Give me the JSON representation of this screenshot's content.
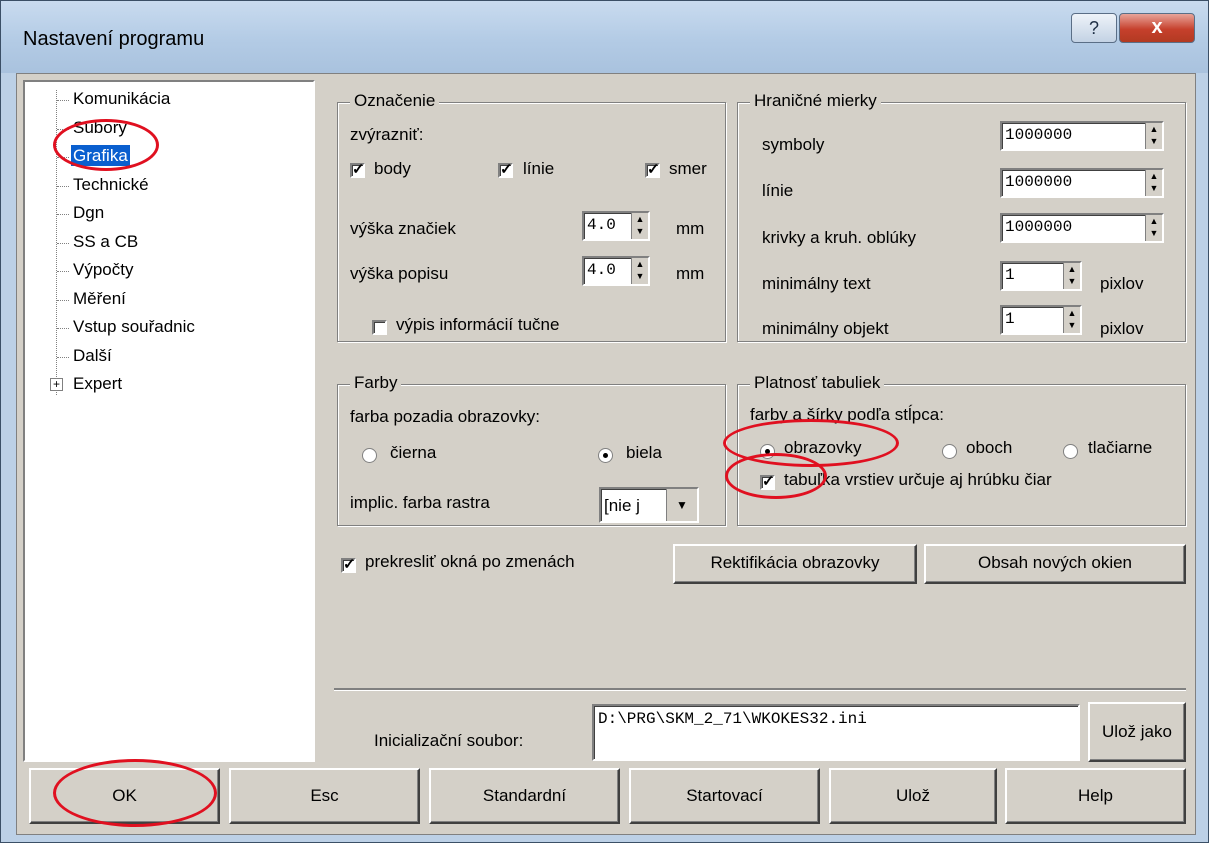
{
  "window": {
    "title": "Nastavení programu",
    "help_symbol": "?",
    "close_symbol": "x"
  },
  "tree": {
    "items": [
      {
        "label": "Komunikácia"
      },
      {
        "label": "Súbory"
      },
      {
        "label": "Grafika",
        "selected": true
      },
      {
        "label": "Technické"
      },
      {
        "label": "Dgn"
      },
      {
        "label": "SS a CB"
      },
      {
        "label": "Výpočty"
      },
      {
        "label": "Měření"
      },
      {
        "label": "Vstup souřadnic"
      },
      {
        "label": "Další"
      },
      {
        "label": "Expert",
        "expandable": true,
        "expander": "+"
      }
    ]
  },
  "oznacenie": {
    "legend": "Označenie",
    "zvyraznit_label": "zvýrazniť:",
    "checkboxes": [
      {
        "label": "body",
        "checked": true
      },
      {
        "label": "línie",
        "checked": true
      },
      {
        "label": "smer",
        "checked": true
      }
    ],
    "vyska_znaciek": {
      "label": "výška značiek",
      "value": "4.0",
      "unit": "mm"
    },
    "vyska_popisu": {
      "label": "výška popisu",
      "value": "4.0",
      "unit": "mm"
    },
    "vypis_tucne": {
      "label": "výpis informácií tučne",
      "checked": false
    }
  },
  "hranicne": {
    "legend": "Hraničné mierky",
    "symboly": {
      "label": "symboly",
      "value": "1000000"
    },
    "linie": {
      "label": "línie",
      "value": "1000000"
    },
    "krivky": {
      "label": "krivky a kruh. oblúky",
      "value": "1000000"
    },
    "min_text": {
      "label": "minimálny text",
      "value": "1",
      "unit": "pixlov"
    },
    "min_objekt": {
      "label": "minimálny objekt",
      "value": "1",
      "unit": "pixlov"
    }
  },
  "farby": {
    "legend": "Farby",
    "pozadie_label": "farba pozadia obrazovky:",
    "cierna": {
      "label": "čierna",
      "selected": false
    },
    "biela": {
      "label": "biela",
      "selected": true
    },
    "raster_label": "implic. farba rastra",
    "raster_value": "[nie j"
  },
  "platnost": {
    "legend": "Platnosť tabuliek",
    "sirky_label": "farby a šírky podľa stĺpca:",
    "obrazovky": {
      "label": "obrazovky",
      "selected": true
    },
    "oboch": {
      "label": "oboch",
      "selected": false
    },
    "tlaciarne": {
      "label": "tlačiarne",
      "selected": false
    },
    "hrubka": {
      "label": "tabuľka vrstiev určuje aj hrúbku čiar",
      "checked": true
    }
  },
  "prekreslit": {
    "label": "prekresliť okná po zmenách",
    "checked": true
  },
  "buttons": {
    "rektifikacia": "Rektifikácia obrazovky",
    "obsah": "Obsah nových okien",
    "uloz_jako": "Ulož jako"
  },
  "ini": {
    "label": "Inicializační soubor:",
    "value": "D:\\PRG\\SKM_2_71\\WKOKES32.ini"
  },
  "bottom": {
    "ok": "OK",
    "esc": "Esc",
    "standard": "Standardní",
    "start": "Startovací",
    "uloz": "Ulož",
    "help": "Help"
  },
  "annotation_color": "#e01020"
}
